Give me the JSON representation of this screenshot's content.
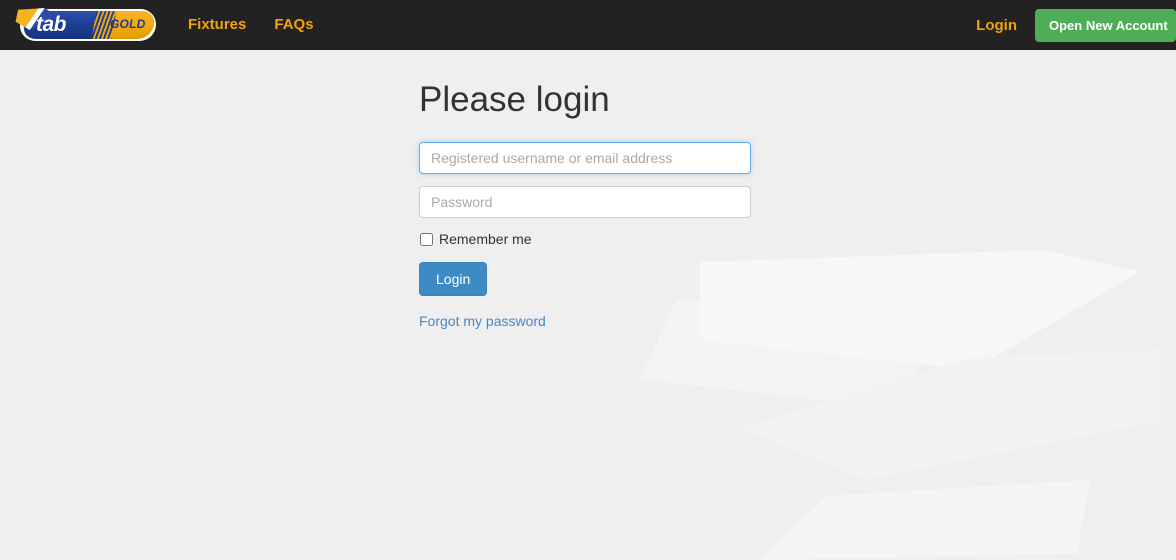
{
  "header": {
    "logo": {
      "name": "tabgold-logo",
      "text_primary": "tab",
      "text_secondary": "GOLD"
    },
    "nav_items": [
      {
        "label": "Fixtures",
        "name": "nav-fixtures"
      },
      {
        "label": "FAQs",
        "name": "nav-faqs"
      }
    ],
    "login_link": "Login",
    "open_account_button": "Open New Account",
    "colors": {
      "background": "#222222",
      "nav_text": "#f0a30a",
      "open_account_button": "#4fad58"
    }
  },
  "main": {
    "title": "Please login",
    "form": {
      "username": {
        "placeholder": "Registered username or email address",
        "value": "",
        "focused": true
      },
      "password": {
        "placeholder": "Password",
        "value": "",
        "focused": false
      },
      "remember_me_label": "Remember me",
      "remember_me_checked": false,
      "submit_label": "Login",
      "forgot_password_label": "Forgot my password"
    },
    "colors": {
      "page_background": "#efefef",
      "title_text": "#333333",
      "submit_button": "#3e8ac4",
      "link_text": "#4a86c5",
      "input_focus_border": "#66afe9"
    }
  }
}
